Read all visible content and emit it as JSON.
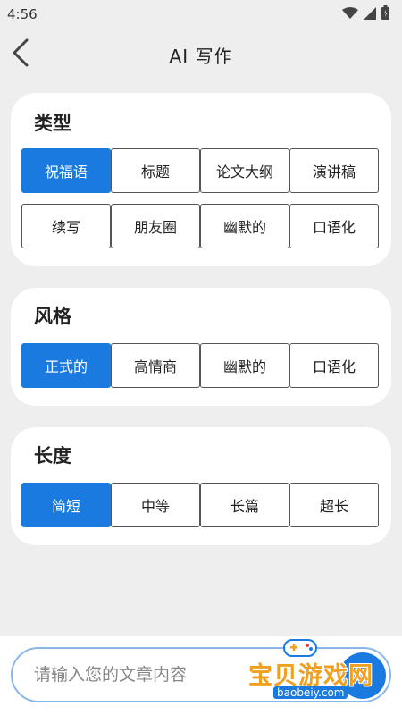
{
  "status_bar": {
    "time": "4:56"
  },
  "header": {
    "title": "AI 写作"
  },
  "sections": [
    {
      "title": "类型",
      "options": [
        "祝福语",
        "标题",
        "论文大纲",
        "演讲稿",
        "续写",
        "朋友圈",
        "幽默的",
        "口语化"
      ],
      "selected": "祝福语"
    },
    {
      "title": "风格",
      "options": [
        "正式的",
        "高情商",
        "幽默的",
        "口语化"
      ],
      "selected": "正式的"
    },
    {
      "title": "长度",
      "options": [
        "简短",
        "中等",
        "长篇",
        "超长"
      ],
      "selected": "简短"
    }
  ],
  "input": {
    "placeholder": "请输入您的文章内容",
    "value": ""
  },
  "watermark": {
    "name": "宝贝游戏网",
    "url": "baobeiy.com"
  },
  "colors": {
    "accent": "#1a7ae0",
    "background": "#eeeeee",
    "card": "#ffffff"
  },
  "icons": {
    "back": "chevron-left-icon",
    "wifi": "wifi-icon",
    "signal": "signal-icon",
    "battery": "battery-icon",
    "send": "send-icon"
  }
}
